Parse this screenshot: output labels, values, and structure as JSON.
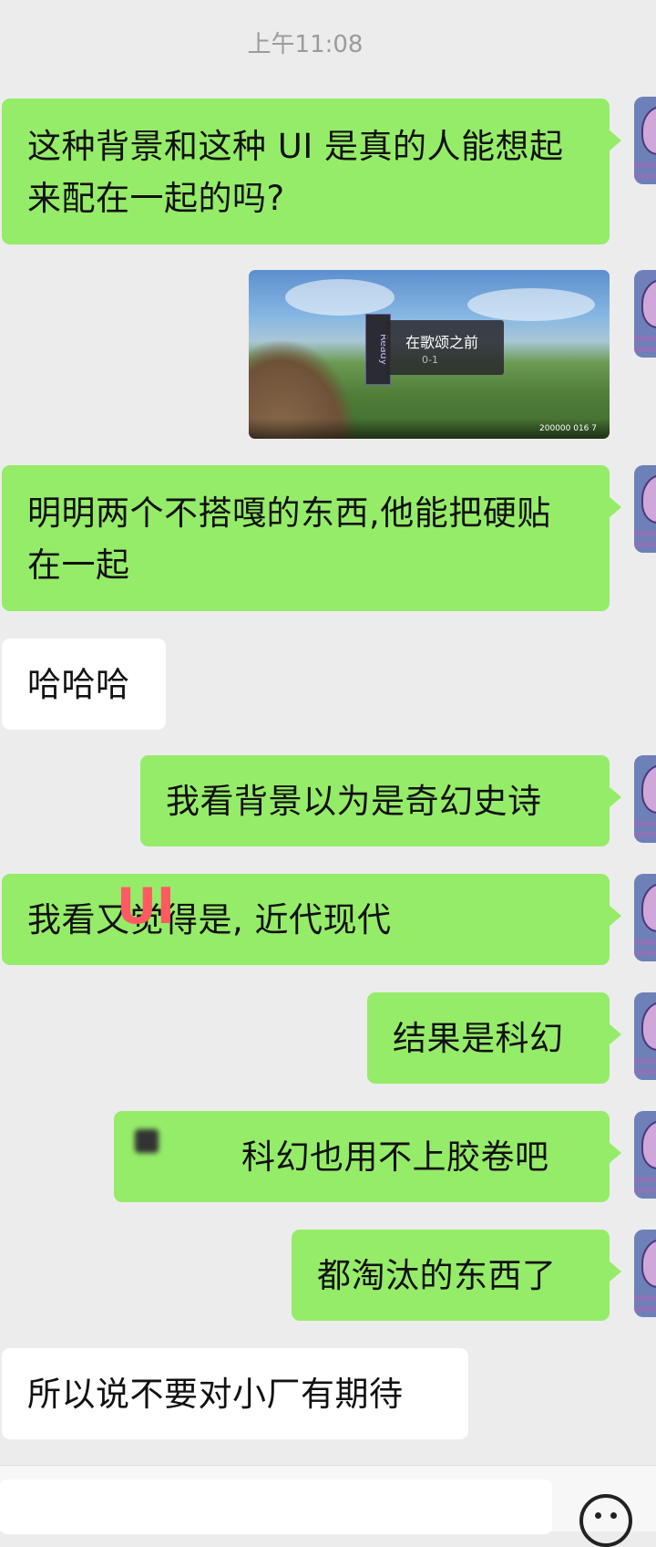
{
  "timestamp": "上午11:08",
  "messages": [
    {
      "side": "right",
      "text": "这种背景和这种 UI 是真的人能想起来配在一起的吗?"
    },
    {
      "side": "right",
      "type": "image",
      "image_texts": {
        "side_label": "Ready",
        "title": "在歌颂之前",
        "subtitle": "0-1",
        "hud": "200000 016 7"
      }
    },
    {
      "side": "right",
      "text": "明明两个不搭嘎的东西,他能把硬贴在一起"
    },
    {
      "side": "left",
      "text": "哈哈哈"
    },
    {
      "side": "right",
      "text": "我看背景以为是奇幻史诗"
    },
    {
      "side": "right",
      "text": "我看又觉得是, 近代现代",
      "overlay": "UI"
    },
    {
      "side": "right",
      "text": "结果是科幻"
    },
    {
      "side": "right",
      "text": "科幻也用不上胶卷吧"
    },
    {
      "side": "right",
      "text": "都淘汰的东西了"
    },
    {
      "side": "left",
      "text": "所以说不要对小厂有期待"
    }
  ],
  "input": {
    "placeholder": ""
  },
  "icons": {
    "emoji": "emoji-icon",
    "avatar": "avatar-image"
  }
}
